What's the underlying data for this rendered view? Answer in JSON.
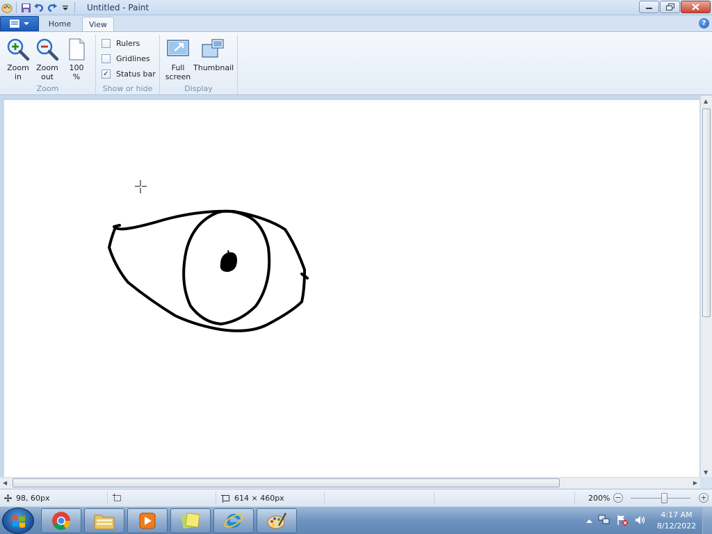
{
  "window": {
    "title": "Untitled - Paint"
  },
  "ribbon": {
    "tabs": [
      {
        "label": "Home"
      },
      {
        "label": "View"
      }
    ],
    "groups": {
      "zoom": {
        "label": "Zoom",
        "zoom_in": {
          "line1": "Zoom",
          "line2": "in"
        },
        "zoom_out": {
          "line1": "Zoom",
          "line2": "out"
        },
        "hundred": {
          "line1": "100",
          "line2": "%"
        }
      },
      "show_or_hide": {
        "label": "Show or hide",
        "rulers": {
          "label": "Rulers",
          "checked": false
        },
        "gridlines": {
          "label": "Gridlines",
          "checked": false
        },
        "status_bar": {
          "label": "Status bar",
          "checked": true,
          "mark": "✓"
        }
      },
      "display": {
        "label": "Display",
        "full_screen": {
          "line1": "Full",
          "line2": "screen"
        },
        "thumbnail": {
          "line1": "Thumbnail"
        }
      }
    },
    "help_label": "?"
  },
  "statusbar": {
    "cursor_position": "98, 60px",
    "canvas_size": "614 × 460px",
    "zoom_level": "200%",
    "zoom_minus": "−",
    "zoom_plus": "+"
  },
  "taskbar": {
    "apps": [
      "Google Chrome",
      "Windows Explorer",
      "Windows Media Player",
      "Sticky Notes",
      "Internet Explorer",
      "Paint"
    ],
    "time": "4:17 AM",
    "date": "8/12/2022"
  },
  "colors": {
    "accent": "#1b5bb8",
    "ribbon_bg": "#e3ecf7",
    "canvas_bg": "#ffffff",
    "stroke": "#000000"
  }
}
